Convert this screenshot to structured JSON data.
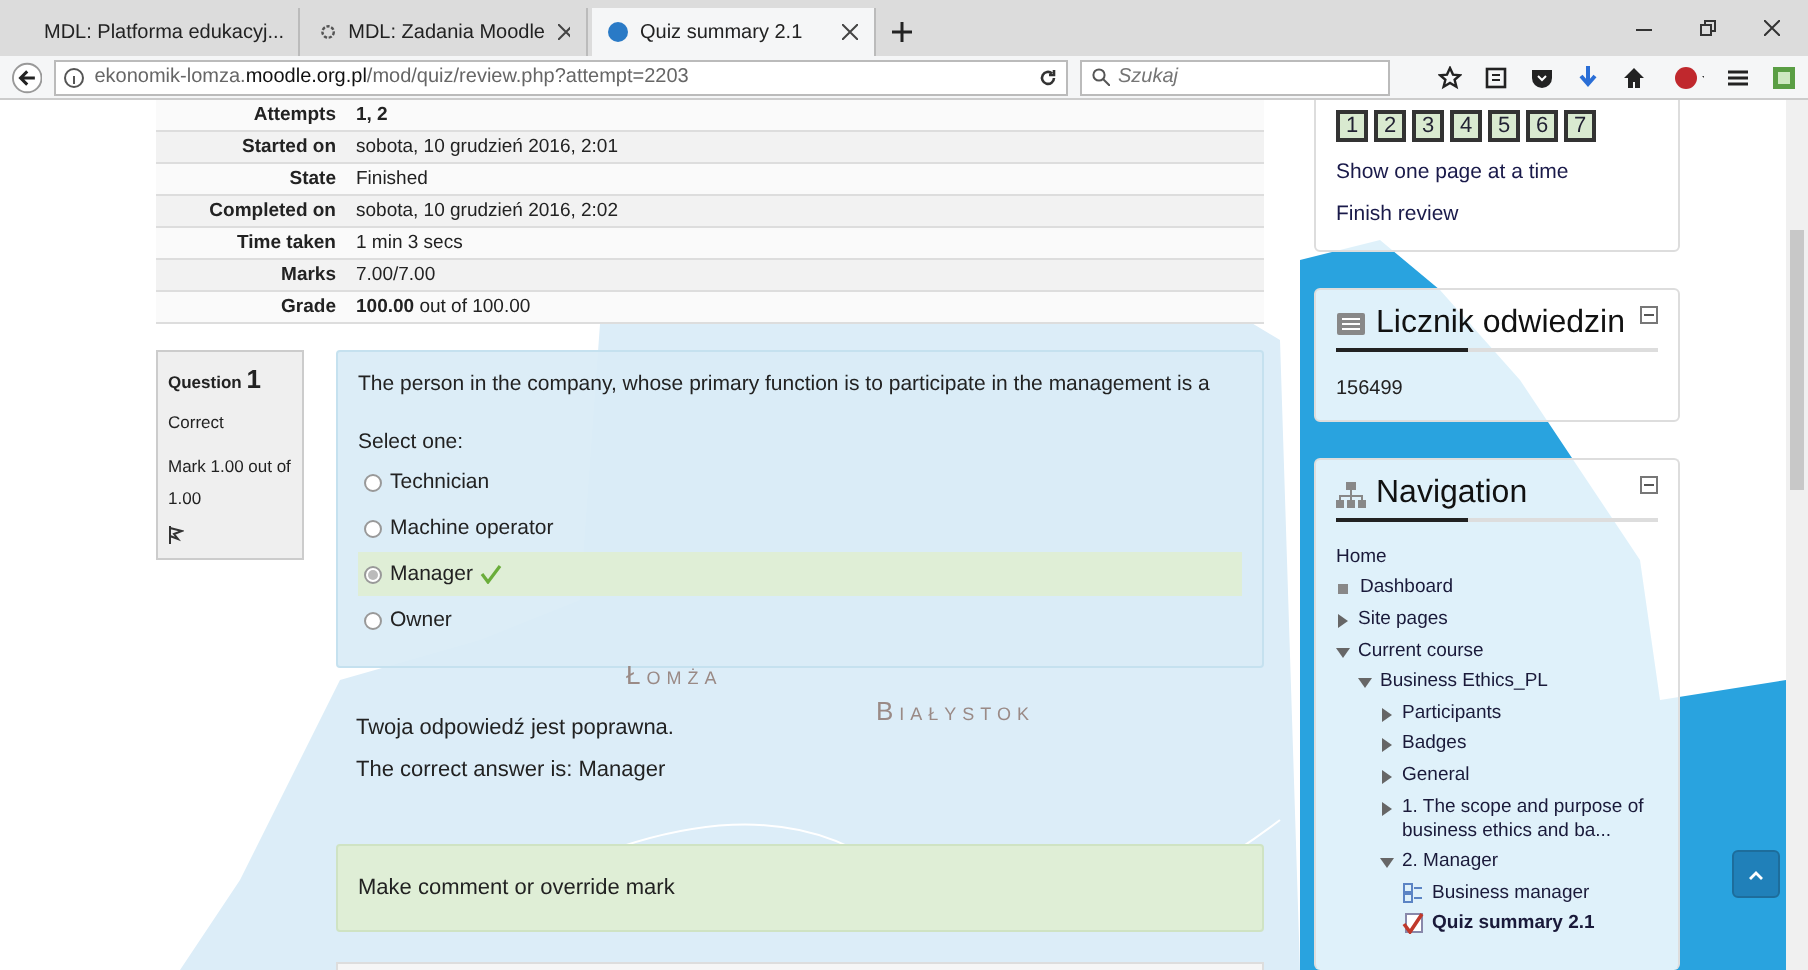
{
  "browser": {
    "tabs": [
      {
        "title": "MDL: Platforma edukacyj...",
        "selected": false
      },
      {
        "title": "MDL: Zadania Moodle",
        "selected": false
      },
      {
        "title": "Quiz summary 2.1",
        "selected": true
      }
    ],
    "url_prefix": "ekonomik-lomza.",
    "url_domain": "moodle.org.pl",
    "url_path": "/mod/quiz/review.php?attempt=2203",
    "search_placeholder": "Szukaj"
  },
  "summary": [
    {
      "label": "Attempts",
      "value": "1, 2",
      "bold": true
    },
    {
      "label": "Started on",
      "value": "sobota, 10 grudzień 2016, 2:01",
      "bold": false
    },
    {
      "label": "State",
      "value": "Finished",
      "bold": false
    },
    {
      "label": "Completed on",
      "value": "sobota, 10 grudzień 2016, 2:02",
      "bold": false
    },
    {
      "label": "Time taken",
      "value": "1 min 3 secs",
      "bold": false
    },
    {
      "label": "Marks",
      "value": "7.00/7.00",
      "bold": false
    },
    {
      "label": "Grade",
      "value": "**100.00** out of 100.00",
      "bold": false
    }
  ],
  "question": {
    "label": "Question",
    "number": "1",
    "status": "Correct",
    "mark": "Mark 1.00 out of 1.00",
    "text": "The person in the company, whose primary function is to participate in the management is a",
    "prompt": "Select one:",
    "options": [
      {
        "label": "Technician",
        "selected": false
      },
      {
        "label": "Machine operator",
        "selected": false
      },
      {
        "label": "Manager",
        "selected": true
      },
      {
        "label": "Owner",
        "selected": false
      }
    ],
    "feedback": [
      "Twoja odpowiedź jest poprawna.",
      "The correct answer is: Manager"
    ],
    "comment_link": "Make comment or override mark"
  },
  "map_labels": [
    "Łomża",
    "Białystok"
  ],
  "quiz_nav": {
    "pages": [
      "1",
      "2",
      "3",
      "4",
      "5",
      "6",
      "7"
    ],
    "links": [
      "Show one page at a time",
      "Finish review"
    ]
  },
  "counter": {
    "title": "Licznik odwiedzin",
    "value": "156499"
  },
  "navigation": {
    "title": "Navigation",
    "items": [
      {
        "label": "Home",
        "kind": "plain"
      },
      {
        "label": "Dashboard",
        "kind": "leaf"
      },
      {
        "label": "Site pages",
        "kind": "branch",
        "expanded": false
      },
      {
        "label": "Current course",
        "kind": "branch",
        "expanded": true,
        "children": [
          {
            "label": "Business Ethics_PL",
            "kind": "branch",
            "expanded": true,
            "children": [
              {
                "label": "Participants",
                "kind": "branch",
                "expanded": false
              },
              {
                "label": "Badges",
                "kind": "branch",
                "expanded": false
              },
              {
                "label": "General",
                "kind": "branch",
                "expanded": false
              },
              {
                "label": "1. The scope and purpose of business ethics and ba...",
                "kind": "branch",
                "expanded": false
              },
              {
                "label": "2. Manager",
                "kind": "branch",
                "expanded": true,
                "children": [
                  {
                    "label": "Business manager",
                    "kind": "page",
                    "selected": false
                  },
                  {
                    "label": "Quiz summary 2.1",
                    "kind": "quiz",
                    "selected": true
                  }
                ]
              }
            ]
          }
        ]
      }
    ]
  }
}
